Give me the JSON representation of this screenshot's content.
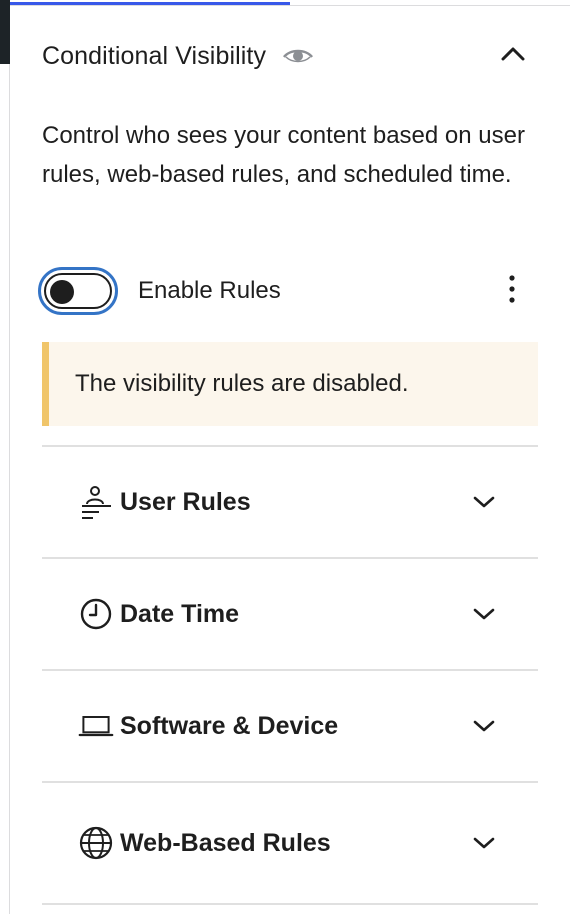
{
  "panel": {
    "title": "Conditional Visibility",
    "description": "Control who sees your content based on user rules, web-based rules, and scheduled time."
  },
  "toggle": {
    "label": "Enable Rules",
    "state": "off"
  },
  "notice": {
    "text": "The visibility rules are disabled."
  },
  "sections": [
    {
      "label": "User Rules",
      "icon": "user-rules-icon"
    },
    {
      "label": "Date Time",
      "icon": "clock-icon"
    },
    {
      "label": "Software & Device",
      "icon": "laptop-icon"
    },
    {
      "label": "Web-Based Rules",
      "icon": "globe-icon"
    }
  ],
  "colors": {
    "accent": "#3858e9",
    "focus_ring": "#3474c6",
    "notice_border": "#f0c56a",
    "notice_bg": "#fcf6ec"
  }
}
